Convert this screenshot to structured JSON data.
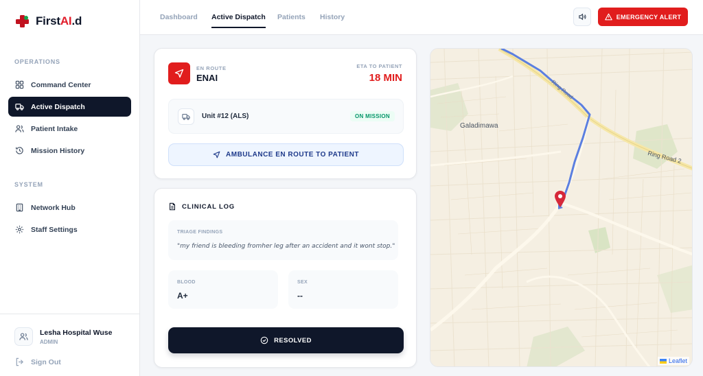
{
  "brand": {
    "name_prefix": "First",
    "name_highlight": "AI",
    "name_suffix": ".d"
  },
  "sidebar": {
    "operations_label": "OPERATIONS",
    "system_label": "SYSTEM",
    "items": [
      {
        "label": "Command Center",
        "icon": "grid-icon"
      },
      {
        "label": "Active Dispatch",
        "icon": "truck-icon",
        "active": true
      },
      {
        "label": "Patient Intake",
        "icon": "users-icon"
      },
      {
        "label": "Mission History",
        "icon": "history-icon"
      },
      {
        "label": "Network Hub",
        "icon": "building-icon"
      },
      {
        "label": "Staff Settings",
        "icon": "gear-icon"
      }
    ],
    "user": {
      "name": "Lesha Hospital Wuse",
      "role": "ADMIN"
    },
    "signout_label": "Sign Out"
  },
  "topbar": {
    "tabs": [
      {
        "label": "Dashboard"
      },
      {
        "label": "Active Dispatch",
        "active": true
      },
      {
        "label": "Patients"
      },
      {
        "label": "History"
      }
    ],
    "alert_label": "EMERGENCY ALERT"
  },
  "status": {
    "route_label": "EN ROUTE",
    "destination": "ENAI",
    "eta_label": "ETA TO PATIENT",
    "eta_value": "18 MIN",
    "unit_name": "Unit #12 (ALS)",
    "unit_status": "ON MISSION",
    "banner": "AMBULANCE EN ROUTE TO PATIENT"
  },
  "clinical": {
    "title": "CLINICAL LOG",
    "triage_label": "TRIAGE FINDINGS",
    "triage_text": "\"my friend is bleeding fromher leg after an accident and it wont stop.\"",
    "blood_label": "BLOOD",
    "blood_value": "A+",
    "sex_label": "SEX",
    "sex_value": "--",
    "resolve_label": "RESOLVED"
  },
  "map": {
    "place_label": "Galadimawa",
    "road_label_1": "Ring Road 2",
    "road_label_2": "Ring Road",
    "attribution": "Leaflet"
  },
  "colors": {
    "accent": "#e11d1d",
    "dark": "#0f172a",
    "route": "#5b7fe0",
    "success": "#059669"
  }
}
